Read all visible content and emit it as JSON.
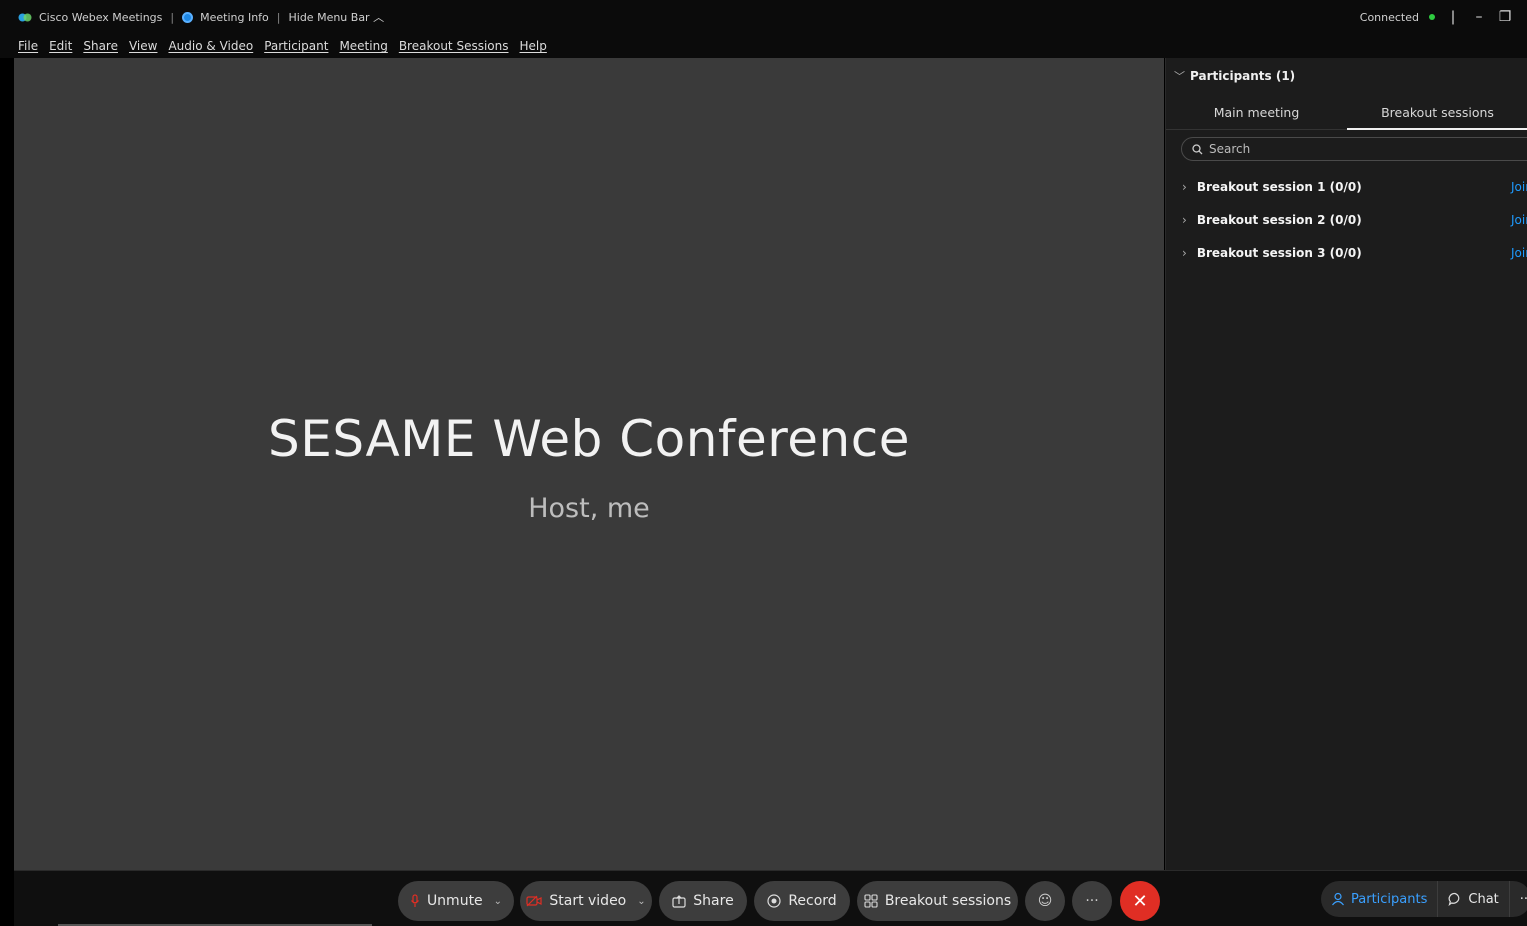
{
  "titlebar": {
    "app_name": "Cisco Webex Meetings",
    "meeting_info": "Meeting Info",
    "hide_menu": "Hide Menu Bar",
    "status": "Connected",
    "status_color": "#2ecc40"
  },
  "menu": [
    "File",
    "Edit",
    "Share",
    "View",
    "Audio & Video",
    "Participant",
    "Meeting",
    "Breakout Sessions",
    "Help"
  ],
  "stage": {
    "title": "SESAME Web Conference",
    "subtitle": "Host, me"
  },
  "panel": {
    "header": "Participants (1)",
    "tabs": [
      {
        "label": "Main meeting",
        "active": false
      },
      {
        "label": "Breakout sessions",
        "active": true
      }
    ],
    "search_placeholder": "Search",
    "sessions": [
      {
        "name": "Breakout session 1 (0/0)",
        "action": "Join"
      },
      {
        "name": "Breakout session 2 (0/0)",
        "action": "Join"
      },
      {
        "name": "Breakout session 3 (0/0)",
        "action": "Join"
      }
    ]
  },
  "controls": {
    "unmute": "Unmute",
    "start_video": "Start video",
    "share": "Share",
    "record": "Record",
    "breakout": "Breakout sessions",
    "participants": "Participants",
    "chat": "Chat"
  },
  "colors": {
    "accent_blue": "#1e9bff",
    "end_red": "#e02e24"
  }
}
